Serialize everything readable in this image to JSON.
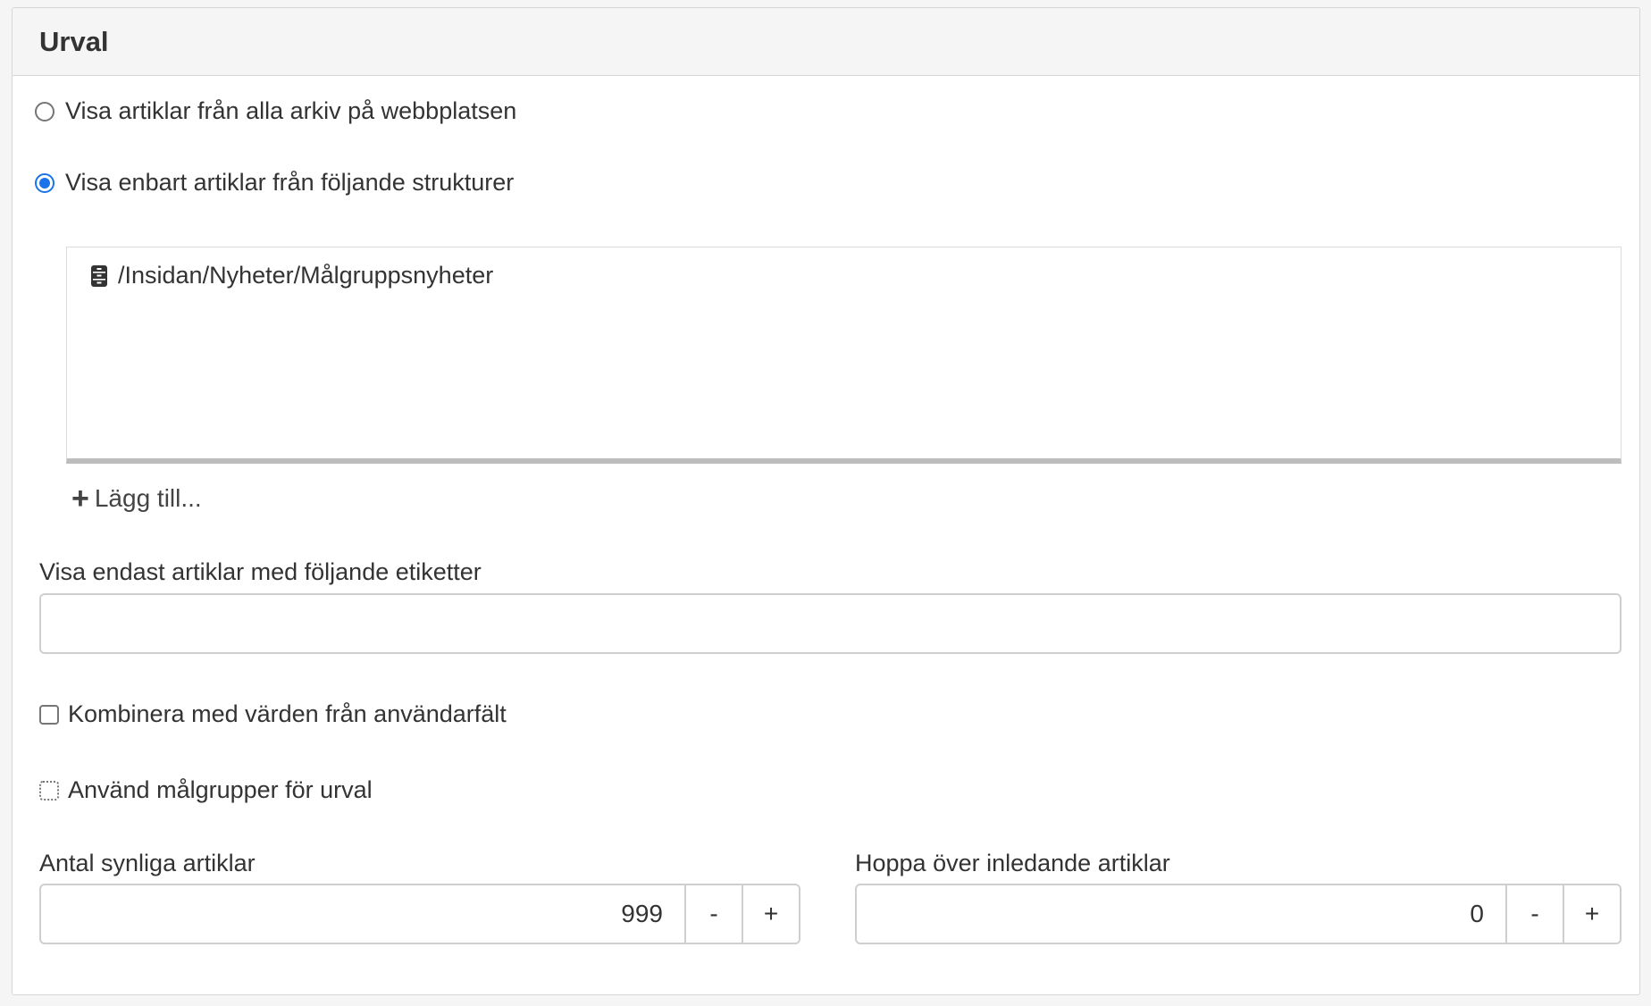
{
  "panel": {
    "title": "Urval"
  },
  "selection": {
    "radio_all_label": "Visa artiklar från alla arkiv på webbplatsen",
    "radio_all_checked": false,
    "radio_only_label": "Visa enbart artiklar från följande strukturer",
    "radio_only_checked": true,
    "structures": [
      {
        "icon": "cabinet-icon",
        "path": "/Insidan/Nyheter/Målgruppsnyheter"
      }
    ],
    "add_label": "Lägg till..."
  },
  "tags": {
    "label": "Visa endast artiklar med följande etiketter",
    "value": ""
  },
  "options": {
    "combine_label": "Kombinera med värden från användarfält",
    "combine_checked": false,
    "target_groups_label": "Använd målgrupper för urval",
    "target_groups_checked": false
  },
  "visible_count": {
    "label": "Antal synliga artiklar",
    "value": "999",
    "minus": "-",
    "plus": "+"
  },
  "skip_count": {
    "label": "Hoppa över inledande artiklar",
    "value": "0",
    "minus": "-",
    "plus": "+"
  },
  "colors": {
    "accent": "#1a73e8",
    "header_bg": "#f5f5f5",
    "border": "#d6d6d6"
  }
}
